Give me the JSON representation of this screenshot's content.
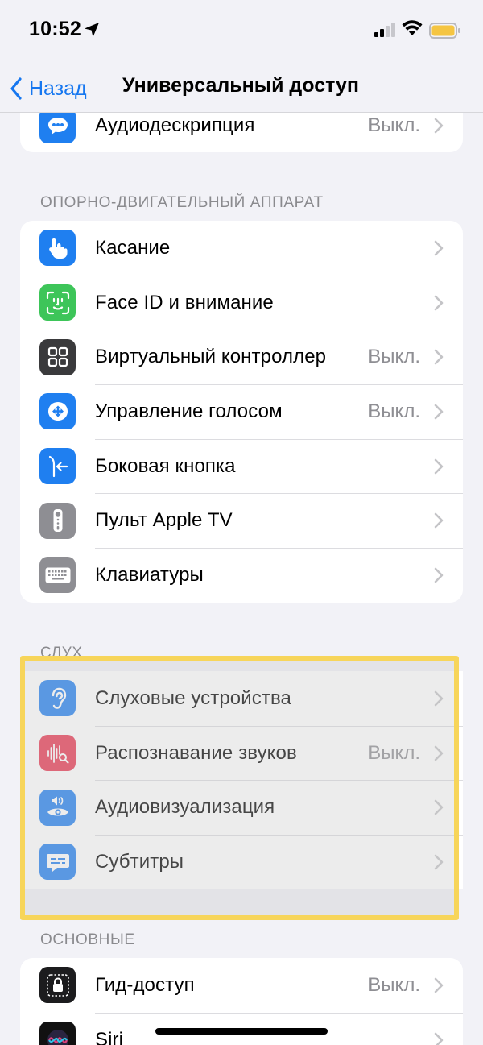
{
  "status_bar": {
    "time": "10:52"
  },
  "nav": {
    "back_label": "Назад",
    "title": "Универсальный доступ"
  },
  "top_group": {
    "items": [
      {
        "label": "Аудиодескрипция",
        "value": "Выкл.",
        "icon": "speech-bubble-icon",
        "color": "#1f7ff0"
      }
    ]
  },
  "motor": {
    "header": "ОПОРНО-ДВИГАТЕЛЬНЫЙ АППАРАТ",
    "items": [
      {
        "label": "Касание",
        "value": "",
        "icon": "hand-pointer-icon",
        "color": "#1f7ff0"
      },
      {
        "label": "Face ID и внимание",
        "value": "",
        "icon": "face-id-icon",
        "color": "#3dc559"
      },
      {
        "label": "Виртуальный контроллер",
        "value": "Выкл.",
        "icon": "grid-icon",
        "color": "#3a3a3c"
      },
      {
        "label": "Управление голосом",
        "value": "Выкл.",
        "icon": "voice-control-icon",
        "color": "#1f7ff0"
      },
      {
        "label": "Боковая кнопка",
        "value": "",
        "icon": "side-button-icon",
        "color": "#1f7ff0"
      },
      {
        "label": "Пульт Apple TV",
        "value": "",
        "icon": "remote-icon",
        "color": "#8e8e93"
      },
      {
        "label": "Клавиатуры",
        "value": "",
        "icon": "keyboard-icon",
        "color": "#8e8e93"
      }
    ]
  },
  "hearing": {
    "header": "СЛУХ",
    "items": [
      {
        "label": "Слуховые устройства",
        "value": "",
        "icon": "ear-icon",
        "color": "#1f7ff0"
      },
      {
        "label": "Распознавание звуков",
        "value": "Выкл.",
        "icon": "sound-recognition-icon",
        "color": "#e8354f"
      },
      {
        "label": "Аудиовизуализация",
        "value": "",
        "icon": "audio-visual-icon",
        "color": "#1f7ff0"
      },
      {
        "label": "Субтитры",
        "value": "",
        "icon": "subtitles-icon",
        "color": "#1f7ff0"
      }
    ]
  },
  "general": {
    "header": "ОСНОВНЫЕ",
    "items": [
      {
        "label": "Гид-доступ",
        "value": "Выкл.",
        "icon": "lock-icon",
        "color": "#1c1c1e"
      },
      {
        "label": "Siri",
        "value": "",
        "icon": "siri-icon",
        "color": "#111111"
      }
    ]
  }
}
